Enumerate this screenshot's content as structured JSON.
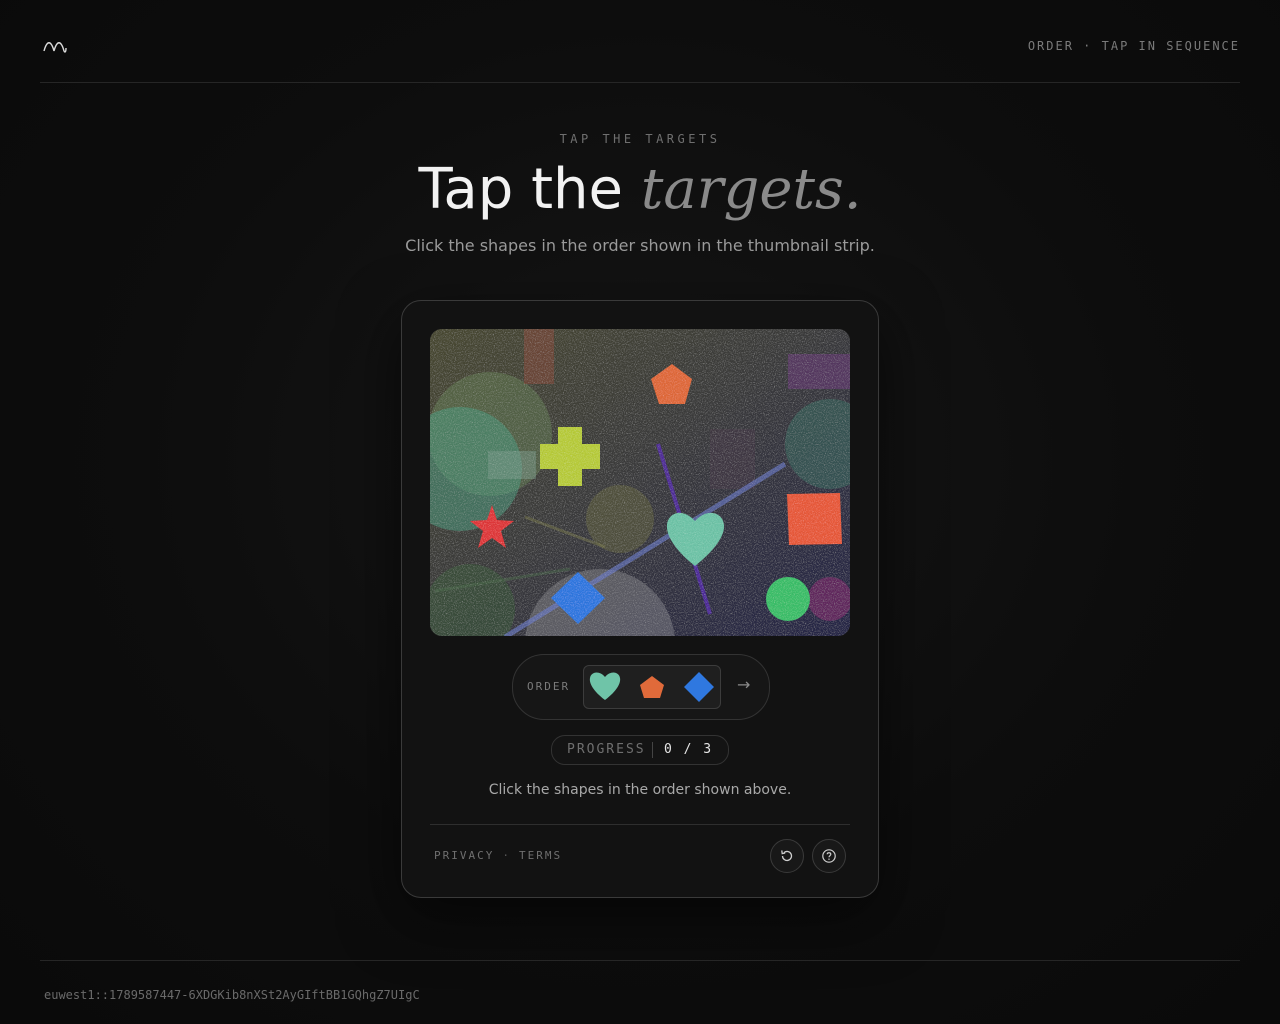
{
  "header": {
    "mode_label": "ORDER · TAP IN SEQUENCE"
  },
  "hero": {
    "eyebrow": "TAP THE TARGETS",
    "headline_plain": "Tap the",
    "headline_accent": "targets.",
    "subtitle": "Click the shapes in the order shown in the thumbnail strip."
  },
  "challenge": {
    "shapes": [
      {
        "name": "pentagon",
        "color": "#e06a3a"
      },
      {
        "name": "cross",
        "color": "#b8cc3a"
      },
      {
        "name": "star",
        "color": "#e0383a"
      },
      {
        "name": "heart",
        "color": "#6fc4a8"
      },
      {
        "name": "square",
        "color": "#e85a3a"
      },
      {
        "name": "diamond",
        "color": "#2f78e0"
      },
      {
        "name": "circle",
        "color": "#3cbf6a"
      }
    ],
    "order_label": "ORDER",
    "order_sequence": [
      {
        "name": "heart",
        "color": "#6fc4a8"
      },
      {
        "name": "pentagon",
        "color": "#e06a3a"
      },
      {
        "name": "diamond",
        "color": "#2f78e0"
      }
    ],
    "arrow": "→",
    "progress_label": "PROGRESS",
    "progress_value": "0 / 3",
    "progress_done": 0,
    "progress_total": 3,
    "instruction": "Click the shapes in the order shown above."
  },
  "footer": {
    "privacy": "PRIVACY",
    "separator": "·",
    "terms": "TERMS",
    "reload_icon": "reload-icon",
    "help_icon": "help-icon"
  },
  "session_id": "euwest1::1789587447-6XDGKib8nXSt2AyGIftBB1GQhgZ7UIgC"
}
